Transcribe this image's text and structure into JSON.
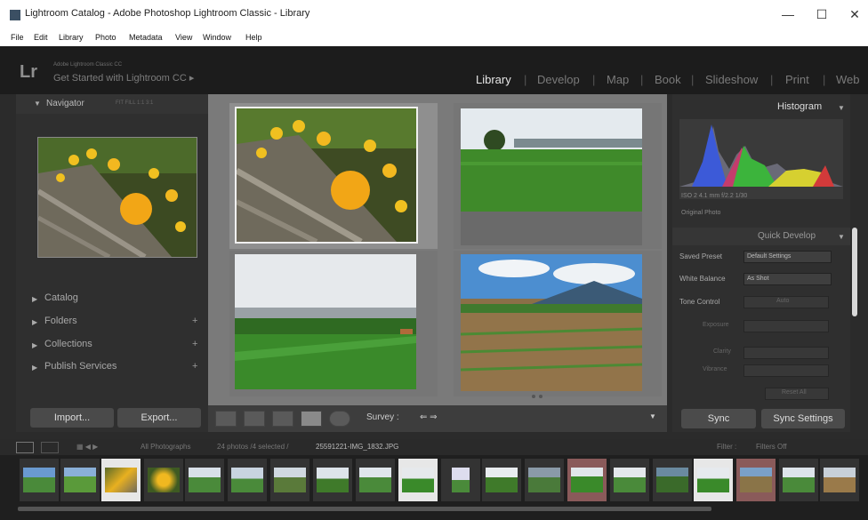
{
  "window": {
    "title": "Lightroom Catalog - Adobe Photoshop Lightroom Classic - Library",
    "minimize": "—",
    "maximize": "☐",
    "close": "✕"
  },
  "menu": [
    "File",
    "Edit",
    "Library",
    "Photo",
    "Metadata",
    "View",
    "Window",
    "Help"
  ],
  "identity_plate": {
    "logo": "Lr",
    "small": "Adobe Lightroom Classic CC",
    "big": "Get Started with Lightroom CC ▸"
  },
  "modules": [
    "Library",
    "Develop",
    "Map",
    "Book",
    "Slideshow",
    "Print",
    "Web"
  ],
  "active_module": "Library",
  "left_panel": {
    "navigator": "Navigator",
    "nav_zoom": "FIT   FILL   1:1   3:1",
    "sections": [
      "Catalog",
      "Folders",
      "Collections",
      "Publish Services"
    ],
    "import_label": "Import...",
    "export_label": "Export..."
  },
  "toolbar": {
    "sort_label": "Survey :",
    "arrows": "⇐ ⇒"
  },
  "right_panel": {
    "histogram": "Histogram",
    "histo_info": "ISO 2    4.1 mm    f/2.2    1/30",
    "original_photo": "Original Photo",
    "quick_develop": "Quick Develop",
    "saved_preset_label": "Saved Preset",
    "saved_preset_value": "Default Settings",
    "white_balance_label": "White Balance",
    "white_balance_value": "As Shot",
    "tone_control_label": "Tone Control",
    "tone_auto": "Auto",
    "exposure_label": "Exposure",
    "clarity_label": "Clarity",
    "vibrance_label": "Vibrance",
    "reset_all": "Reset All",
    "sync_label": "Sync",
    "sync_settings_label": "Sync Settings"
  },
  "filmstrip": {
    "source": "All Photographs",
    "count_text": "24 photos /4 selected /",
    "filename": "25591221-IMG_1832.JPG",
    "filter_label": "Filter :",
    "filter_value": "Filters Off"
  },
  "colors": {
    "active_module": "#e6e6e6",
    "inactive_module": "#7a7a7a",
    "grid_bg": "#7a7a7a"
  }
}
